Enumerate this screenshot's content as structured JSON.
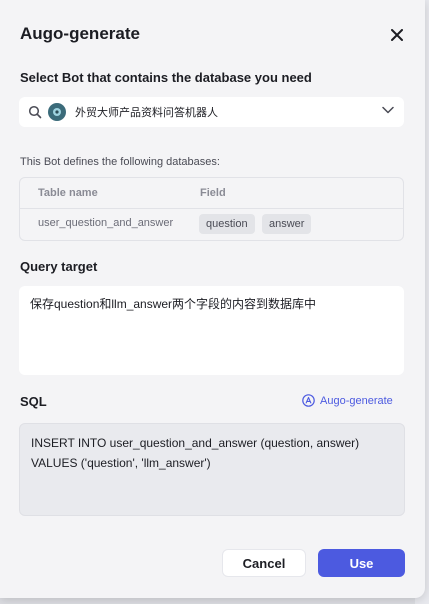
{
  "dialog": {
    "title": "Augo-generate",
    "close_icon": "close-icon"
  },
  "bot_select": {
    "label": "Select Bot that contains the database you need",
    "selected_bot": "外贸大师产品资料问答机器人",
    "icons": [
      "search-icon",
      "bot-avatar",
      "chevron-down-icon"
    ]
  },
  "database": {
    "description": "This Bot defines the following databases:",
    "headers": [
      "Table name",
      "Field"
    ],
    "rows": [
      {
        "table_name": "user_question_and_answer",
        "fields": [
          "question",
          "answer"
        ]
      }
    ]
  },
  "query_target": {
    "label": "Query target",
    "value": "保存question和llm_answer两个字段的内容到数据库中"
  },
  "sql": {
    "label": "SQL",
    "auto_generate_label": "Augo-generate",
    "line1": "INSERT INTO user_question_and_answer (question, answer)",
    "line2": "VALUES ('question', 'llm_answer')"
  },
  "footer": {
    "cancel_label": "Cancel",
    "use_label": "Use"
  },
  "colors": {
    "accent": "#4c5ae0",
    "background": "#f4f4f6"
  }
}
